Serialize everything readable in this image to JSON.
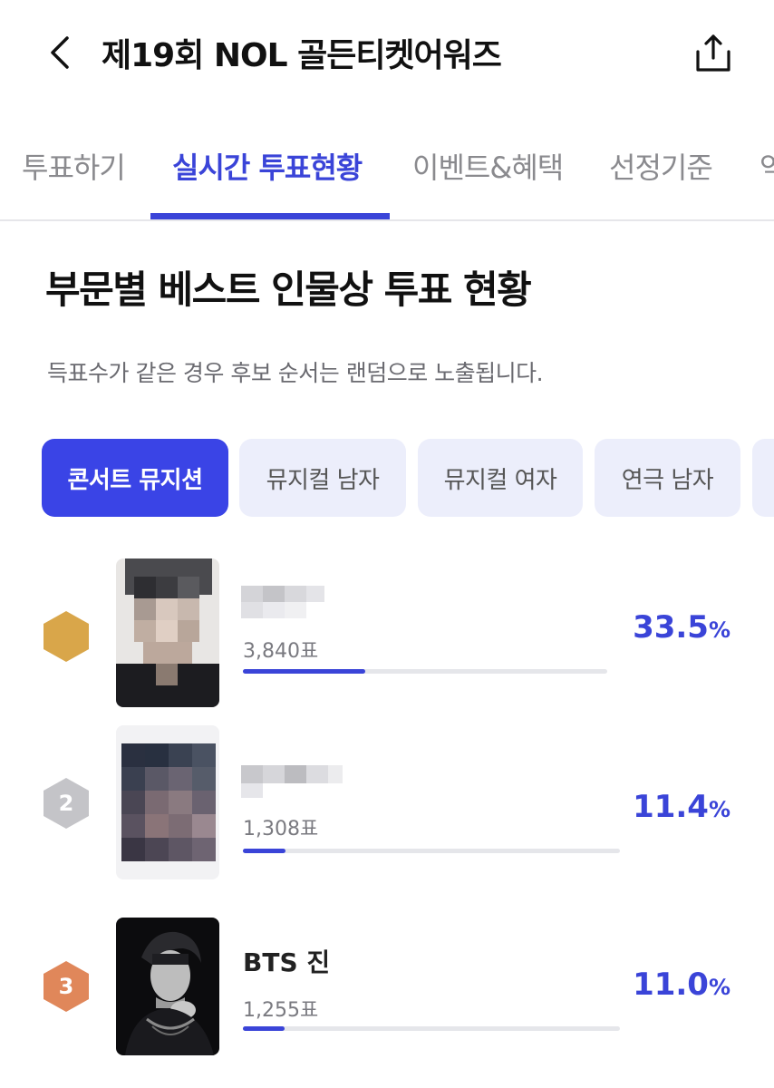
{
  "header": {
    "title": "제19회 NOL 골든티켓어워즈",
    "back_icon": "chevron-left-icon",
    "share_icon": "share-icon"
  },
  "tabs": [
    {
      "label": "투표하기",
      "active": false
    },
    {
      "label": "실시간 투표현황",
      "active": true
    },
    {
      "label": "이벤트&혜택",
      "active": false
    },
    {
      "label": "선정기준",
      "active": false
    },
    {
      "label": "역",
      "active": false
    }
  ],
  "section": {
    "title": "부문별 베스트 인물상 투표 현황",
    "note": "득표수가 같은 경우 후보 순서는 랜덤으로 노출됩니다."
  },
  "categories": [
    {
      "label": "콘서트 뮤지션",
      "active": true
    },
    {
      "label": "뮤지컬 남자",
      "active": false
    },
    {
      "label": "뮤지컬 여자",
      "active": false
    },
    {
      "label": "연극 남자",
      "active": false
    }
  ],
  "ranking": [
    {
      "rank": "",
      "name": "",
      "votes": "3,840표",
      "percent": "33.5",
      "unit": "%",
      "share": 0.335,
      "badge_color": "#d9a64a"
    },
    {
      "rank": "2",
      "name": "",
      "votes": "1,308표",
      "percent": "11.4",
      "unit": "%",
      "share": 0.114,
      "badge_color": "#c4c4c8"
    },
    {
      "rank": "3",
      "name": "BTS 진",
      "votes": "1,255표",
      "percent": "11.0",
      "unit": "%",
      "share": 0.11,
      "badge_color": "#e0875a"
    }
  ],
  "colors": {
    "accent": "#3a44d8",
    "chip_bg": "#eceefb",
    "bar_track": "#e5e6ea"
  }
}
